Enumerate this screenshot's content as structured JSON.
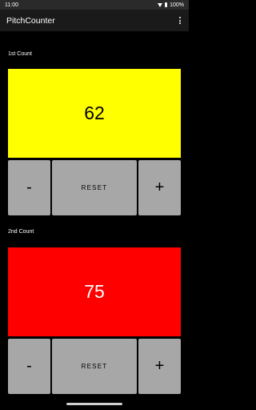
{
  "status_bar": {
    "time": "11:00",
    "battery": "100%",
    "wifi_icon": "wifi-icon",
    "battery_icon": "battery-icon"
  },
  "app_bar": {
    "title": "PitchCounter",
    "overflow_icon": "overflow-menu-icon"
  },
  "counters": [
    {
      "label": "1st Count",
      "value": "62",
      "bg_color": "#ffff00",
      "text_color": "#000000",
      "minus_label": "-",
      "reset_label": "RESET",
      "plus_label": "+"
    },
    {
      "label": "2nd Count",
      "value": "75",
      "bg_color": "#ff0000",
      "text_color": "#ffffff",
      "minus_label": "-",
      "reset_label": "RESET",
      "plus_label": "+"
    }
  ],
  "colors": {
    "button_bg": "#a7a7a7",
    "app_bar_bg": "#1a1a1a",
    "background": "#000000"
  }
}
